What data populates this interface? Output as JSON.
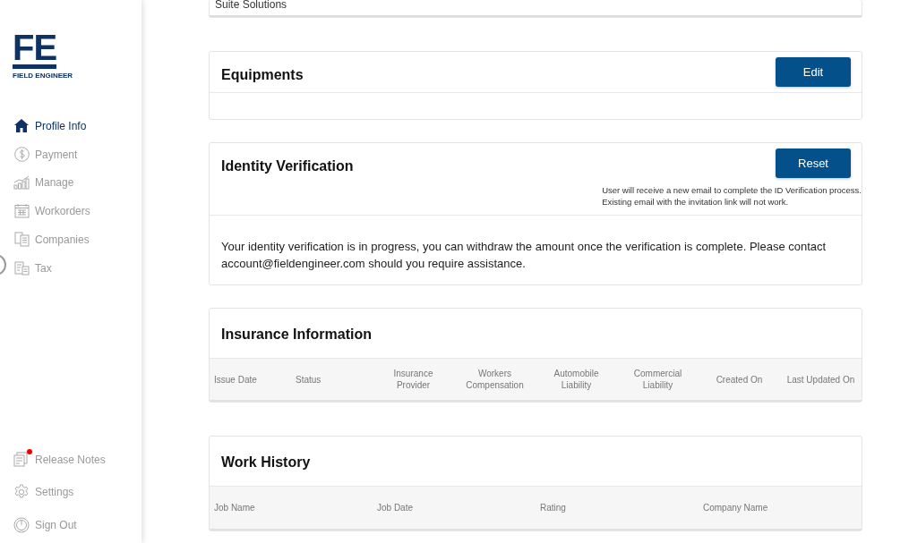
{
  "sidebar": {
    "logo": {
      "mark": "FE",
      "name": "FIELD ENGINEER"
    },
    "items": [
      {
        "label": "Profile Info",
        "selected": true
      },
      {
        "label": "Payment",
        "selected": false
      },
      {
        "label": "Manage",
        "selected": false
      },
      {
        "label": "Workorders",
        "selected": false
      },
      {
        "label": "Companies",
        "selected": false
      },
      {
        "label": "Tax",
        "selected": false
      }
    ],
    "footer_items": [
      {
        "label": "Release Notes",
        "notification": true
      },
      {
        "label": "Settings",
        "notification": false
      },
      {
        "label": "Sign Out",
        "notification": false
      }
    ]
  },
  "cards": [
    {
      "kind": "partial",
      "text": "Suite Solutions"
    },
    {
      "kind": "section",
      "title": "Equipments",
      "button": "Edit"
    },
    {
      "kind": "section",
      "title": "Identity Verification",
      "button": "Reset",
      "note": [
        "User will receive a new email to complete the ID Verification process.",
        "Existing email with the invitation link will not work."
      ],
      "message": "Your identity verification is in progress, you can withdraw the amount once the verification is complete. Please contact account@fieldengineer.com should you require assistance."
    },
    {
      "kind": "table",
      "title": "Insurance Information",
      "columns": [
        "Issue Date",
        "Status",
        "Insurance Provider",
        "Workers Compensation",
        "Automobile Liability",
        "Commercial Liability",
        "Created On",
        "Last Updated On"
      ]
    },
    {
      "kind": "table",
      "title": "Work History",
      "columns": [
        "Job Name",
        "Job Date",
        "Rating",
        "Company Name"
      ]
    }
  ]
}
